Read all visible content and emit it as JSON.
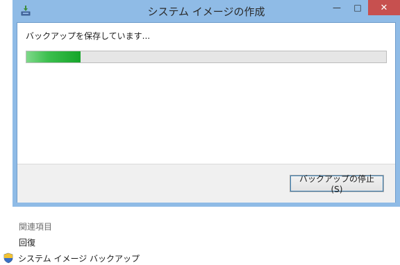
{
  "window": {
    "title": "システム イメージの作成",
    "controls": {
      "minimize": "—",
      "maximize": "□",
      "close": "✕"
    },
    "frame_color": "#8fbbe6"
  },
  "dialog": {
    "status_text": "バックアップを保存しています...",
    "progress": {
      "percent": 15,
      "color": "#16a52a"
    },
    "stop_button_label": "バックアップの停止(S)"
  },
  "related": {
    "heading": "関連項目",
    "items": [
      {
        "label": "回復"
      },
      {
        "label": "システム イメージ バックアップ",
        "icon": "uac-shield-icon"
      }
    ]
  }
}
